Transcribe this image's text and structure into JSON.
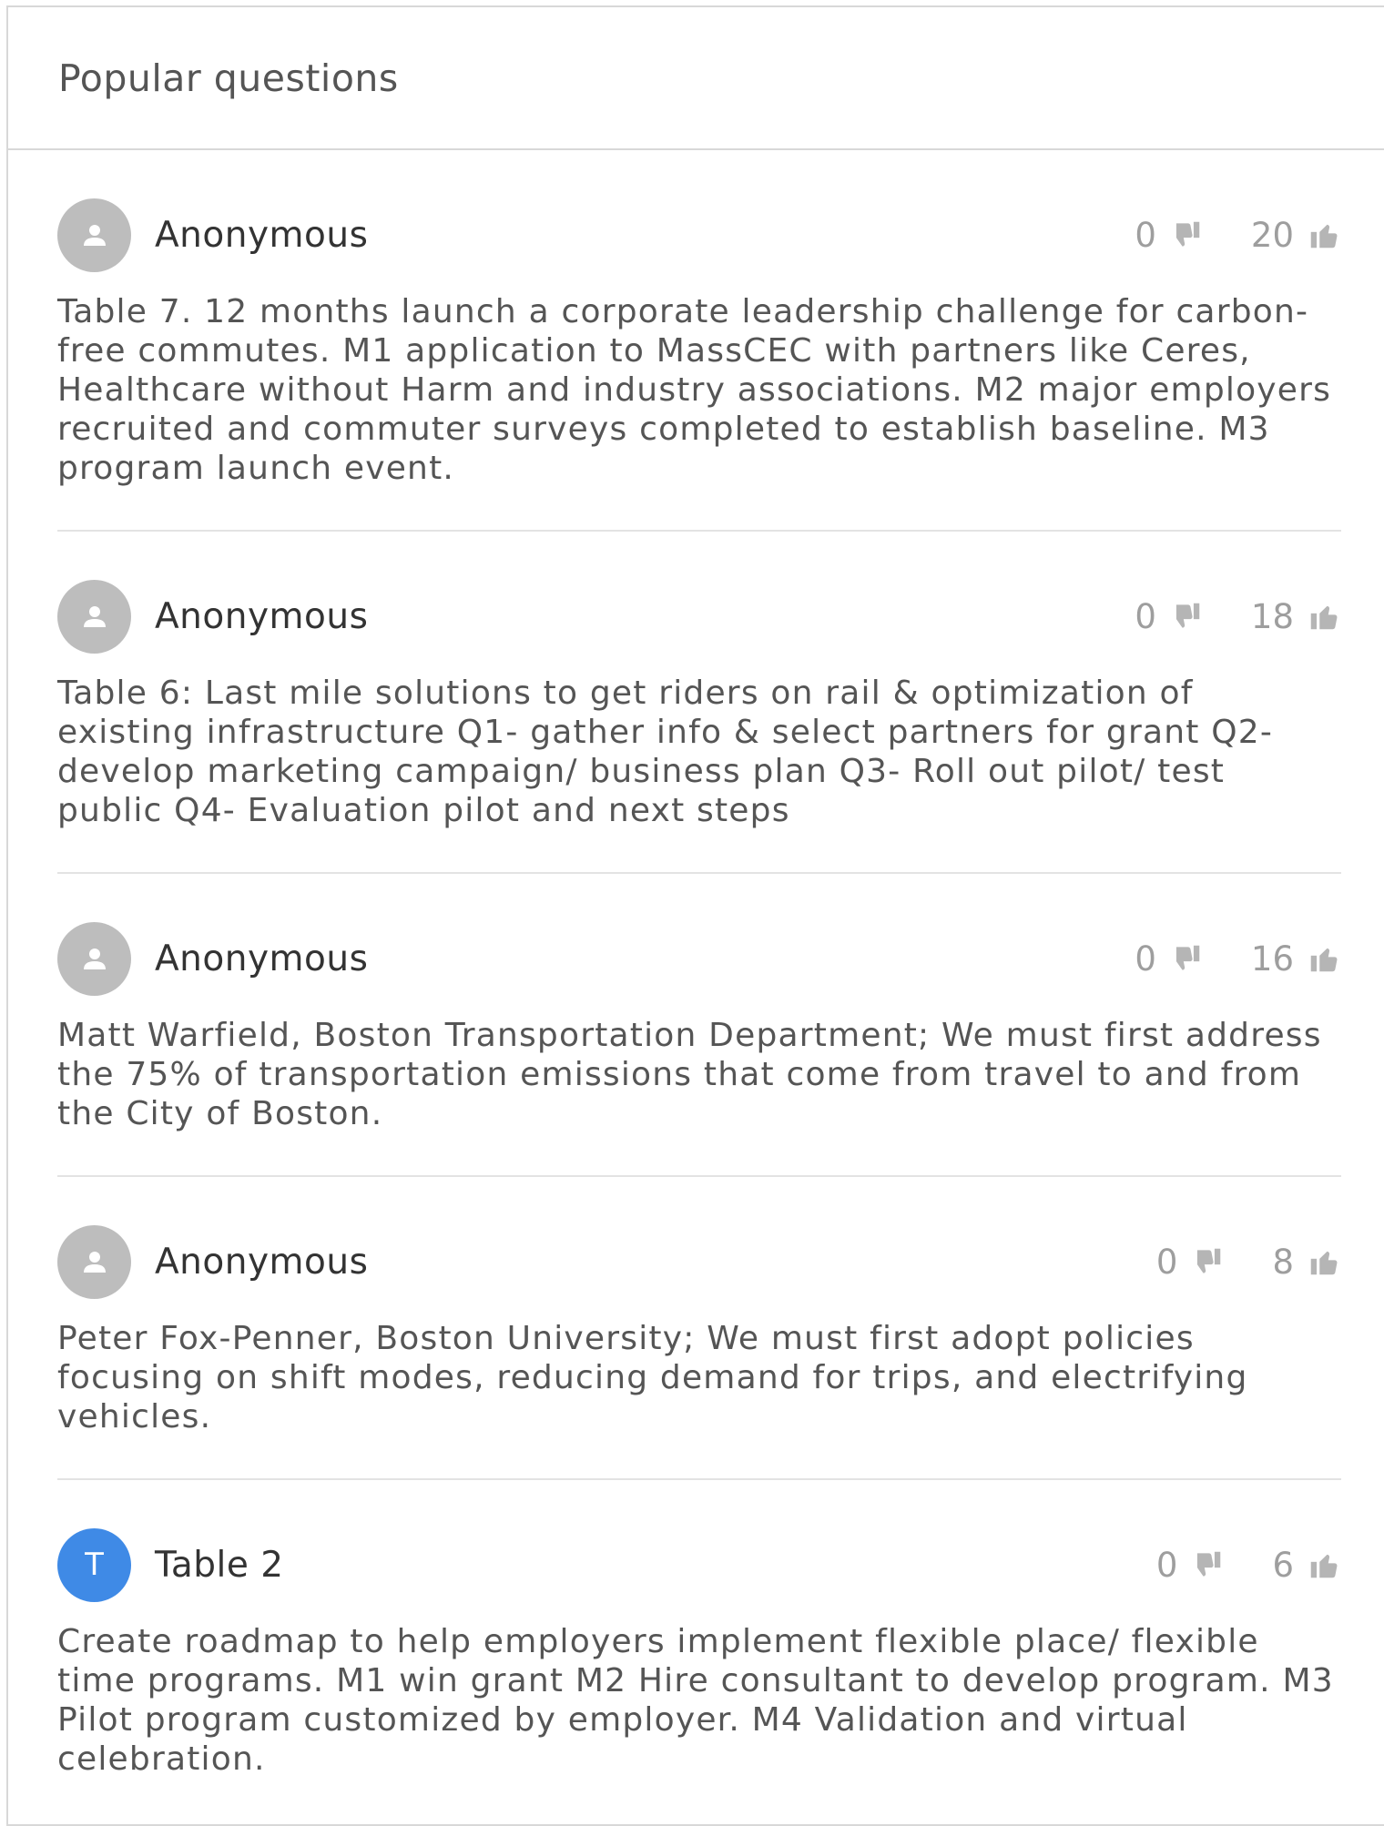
{
  "header": {
    "title": "Popular questions"
  },
  "colors": {
    "avatar_default": "#bdbdbd",
    "avatar_letter": "#3f8ae6",
    "vote_gray": "#9e9e9e"
  },
  "questions": [
    {
      "author": "Anonymous",
      "avatar_letter": "",
      "avatar_icon": "user-icon",
      "downvotes": "0",
      "upvotes": "20",
      "text": "Table 7. 12 months launch a corporate leadership challenge for carbon-free commutes. M1 application to MassCEC with partners like Ceres, Healthcare without Harm and industry associations. M2 major employers recruited and commuter surveys completed to establish baseline. M3 program launch event."
    },
    {
      "author": "Anonymous",
      "avatar_letter": "",
      "avatar_icon": "user-icon",
      "downvotes": "0",
      "upvotes": "18",
      "text": "Table 6: Last mile solutions to get riders on rail & optimization of existing infrastructure Q1- gather info & select partners for grant Q2- develop marketing campaign/ business plan Q3- Roll out pilot/ test public Q4- Evaluation pilot and next steps"
    },
    {
      "author": "Anonymous",
      "avatar_letter": "",
      "avatar_icon": "user-icon",
      "downvotes": "0",
      "upvotes": "16",
      "text": "Matt Warfield, Boston Transportation Department; We must first address the 75% of transportation emissions that come from travel to and from the City of Boston."
    },
    {
      "author": "Anonymous",
      "avatar_letter": "",
      "avatar_icon": "user-icon",
      "downvotes": "0",
      "upvotes": "8",
      "text": "Peter Fox-Penner, Boston University; We must first adopt policies focusing on shift modes, reducing demand for trips, and electrifying vehicles."
    },
    {
      "author": "Table 2",
      "avatar_letter": "T",
      "avatar_icon": "",
      "downvotes": "0",
      "upvotes": "6",
      "text": "Create roadmap to help employers implement flexible place/ flexible time programs. M1 win grant M2 Hire consultant to develop program. M3 Pilot program customized by employer. M4 Validation and virtual celebration."
    }
  ]
}
